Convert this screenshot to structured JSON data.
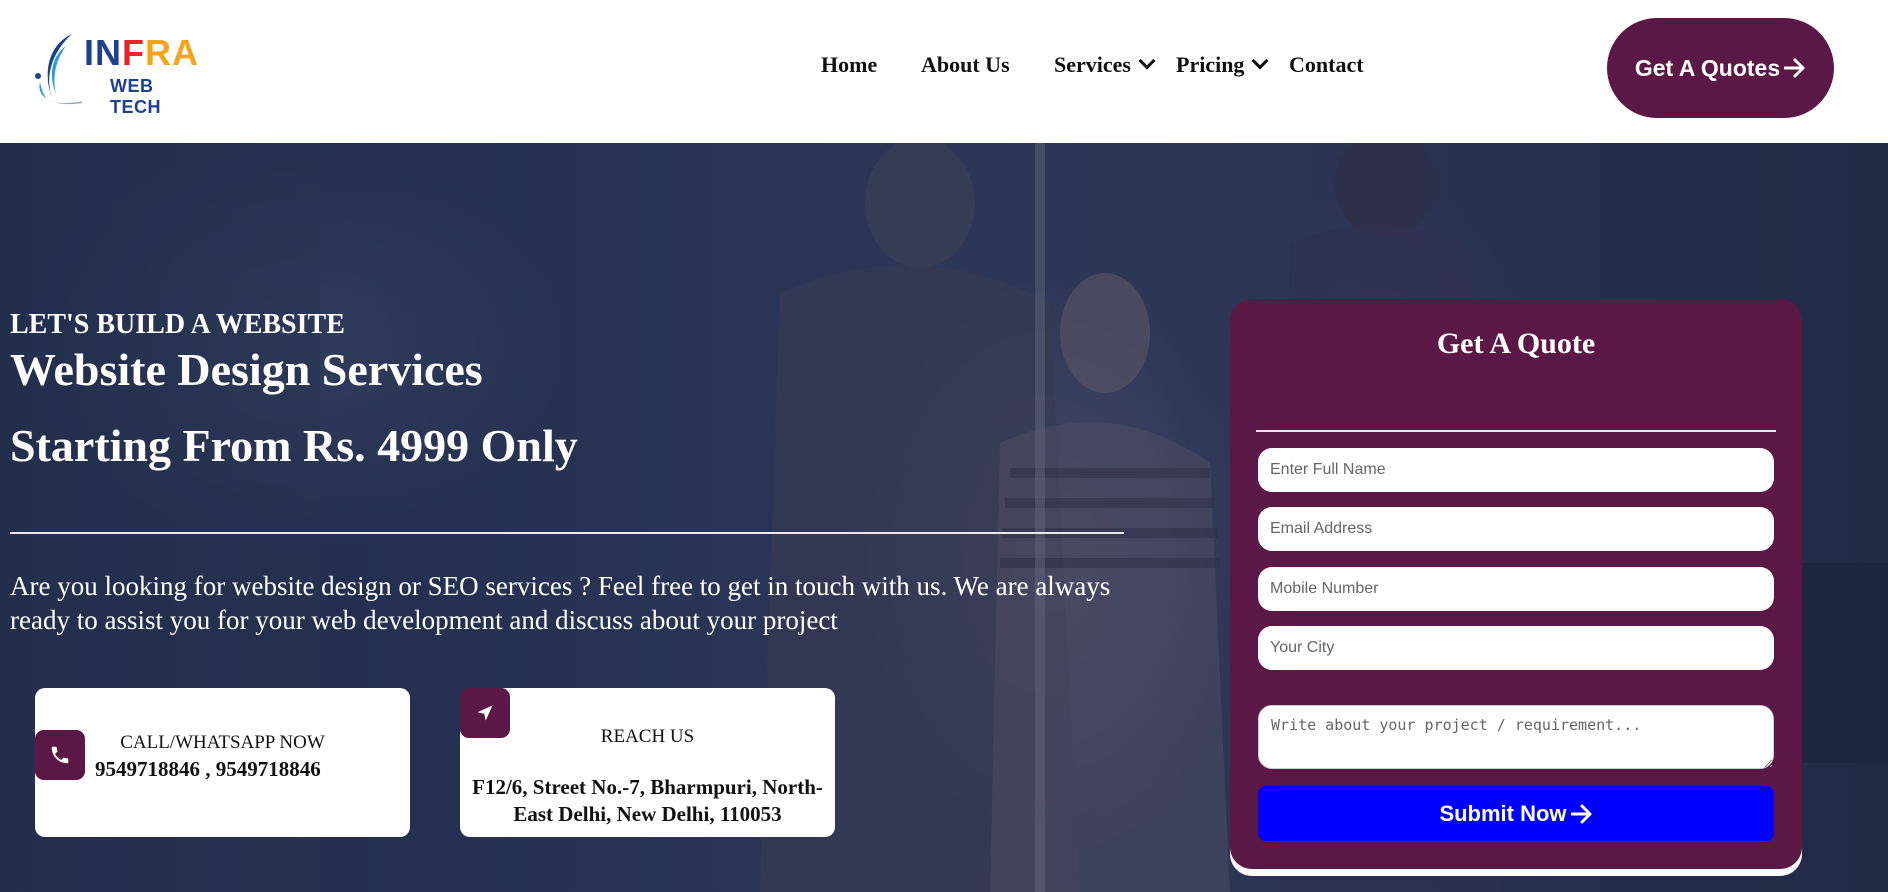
{
  "brand": {
    "name_part1": "IN",
    "name_part2": "F",
    "name_part3": "RA",
    "sub": "WEB TECH",
    "colors": {
      "blue": "#1f3f8f",
      "red": "#e8262a",
      "orange": "#f6a51a"
    }
  },
  "nav": {
    "items": [
      {
        "label": "Home",
        "dropdown": false
      },
      {
        "label": "About Us",
        "dropdown": false
      },
      {
        "label": "Services",
        "dropdown": true
      },
      {
        "label": "Pricing",
        "dropdown": true
      },
      {
        "label": "Contact",
        "dropdown": false
      }
    ],
    "cta_label": "Get A Quotes",
    "cta_icon": "arrow-right-icon"
  },
  "hero": {
    "eyebrow": "LET'S BUILD A WEBSITE",
    "title": "Website Design Services",
    "subtitle": "Starting From Rs. 4999 Only",
    "description": "Are you looking for website design or SEO services ? Feel free to get in touch with us. We are always ready to assist you for your web development and discuss about your project"
  },
  "contact_cards": {
    "call": {
      "icon": "phone-icon",
      "label": "CALL/WHATSAPP NOW",
      "value": "9549718846 , 9549718846"
    },
    "reach": {
      "icon": "location-arrow-icon",
      "label": "REACH US",
      "value": "F12/6, Street No.-7, Bharmpuri, North-East Delhi, New Delhi, 110053"
    }
  },
  "quote_form": {
    "title": "Get A Quote",
    "fields": {
      "name_placeholder": "Enter Full Name",
      "email_placeholder": "Email Address",
      "mobile_placeholder": "Mobile Number",
      "city_placeholder": "Your City",
      "message_placeholder": "Write about your project / requirement..."
    },
    "submit_label": "Submit Now",
    "submit_color": "#0000ff"
  },
  "theme": {
    "accent": "#5b1846",
    "hero_overlay": "#2a3556"
  }
}
